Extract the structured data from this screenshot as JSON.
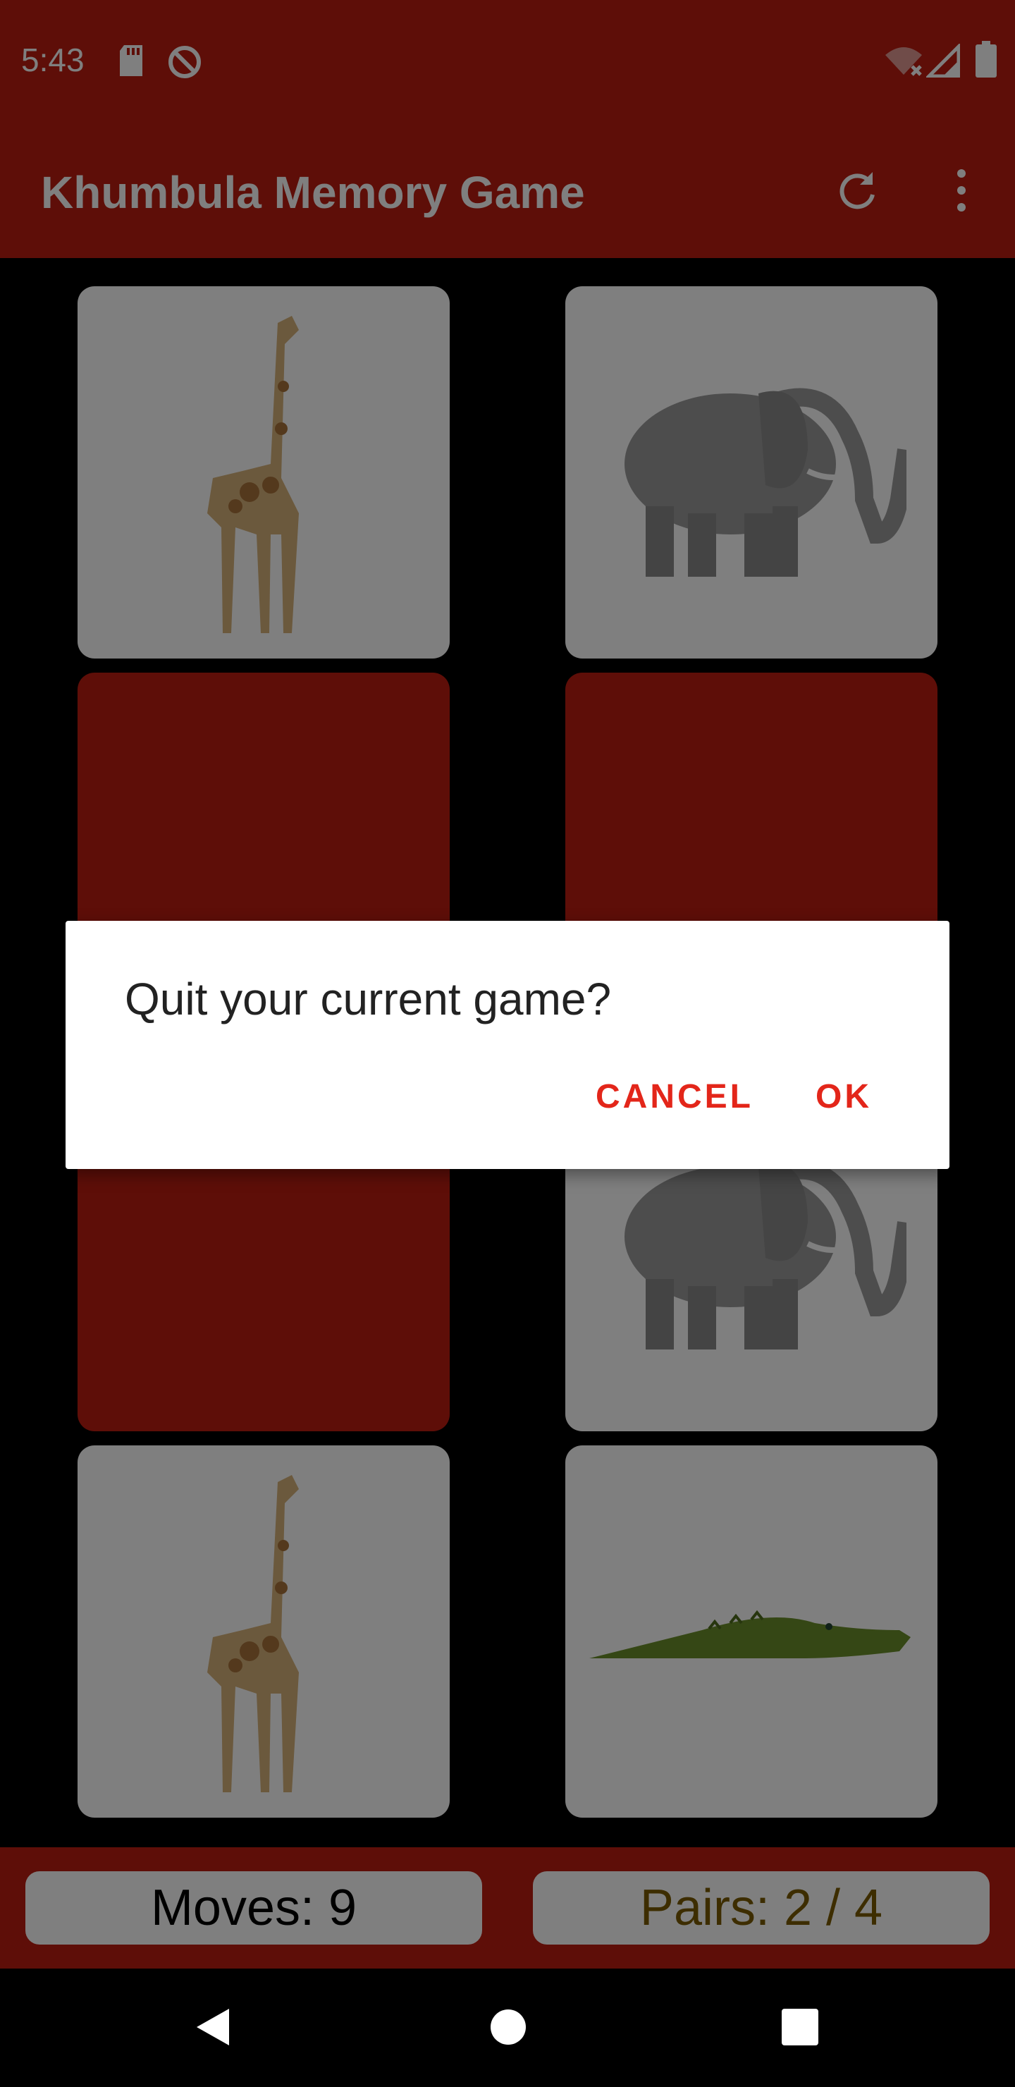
{
  "status_bar": {
    "time": "5:43",
    "icons": [
      "sd-card-icon",
      "no-sync-icon",
      "wifi-off-icon",
      "signal-icon",
      "battery-icon"
    ]
  },
  "app_bar": {
    "title": "Khumbula Memory Game",
    "actions": [
      "refresh-icon",
      "more-vert-icon"
    ]
  },
  "board": {
    "cards": [
      {
        "state": "face",
        "animal": "giraffe"
      },
      {
        "state": "face",
        "animal": "elephant"
      },
      {
        "state": "back",
        "animal": ""
      },
      {
        "state": "back",
        "animal": ""
      },
      {
        "state": "back",
        "animal": ""
      },
      {
        "state": "face",
        "animal": "elephant"
      },
      {
        "state": "face",
        "animal": "giraffe"
      },
      {
        "state": "face",
        "animal": "crocodile"
      }
    ]
  },
  "stats": {
    "moves": "Moves: 9",
    "pairs": "Pairs: 2 / 4"
  },
  "dialog": {
    "title": "Quit your current game?",
    "cancel": "CANCEL",
    "ok": "OK"
  },
  "colors": {
    "primary": "#bd1c10",
    "accent": "#e3261a",
    "pairs_text": "#7a5b00"
  }
}
